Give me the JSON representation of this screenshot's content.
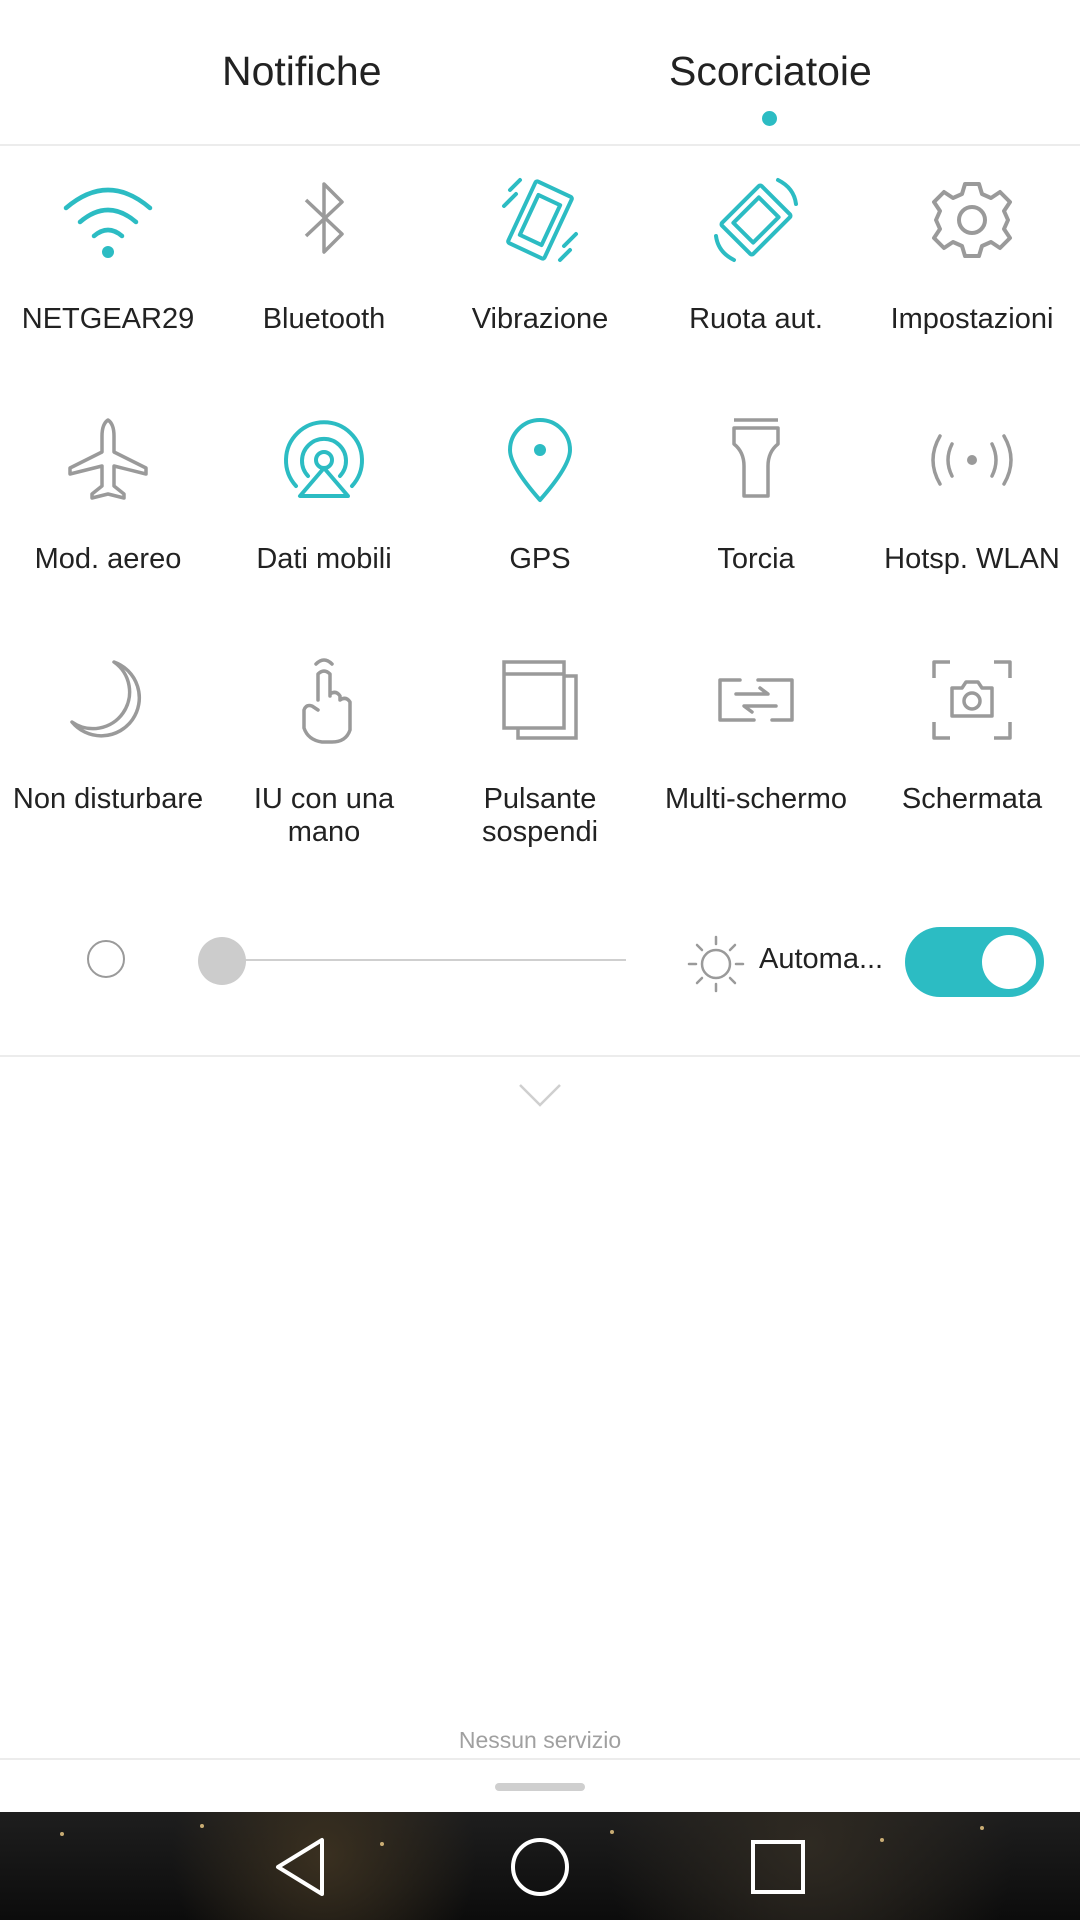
{
  "tabs": {
    "notifiche": "Notifiche",
    "scorciatoie": "Scorciatoie",
    "active": "Scorciatoie"
  },
  "colors": {
    "accent": "#2cbcc3",
    "inactive_icon": "#9a9a9a"
  },
  "tiles": [
    {
      "label": "NETGEAR29",
      "icon": "wifi-icon",
      "active": true
    },
    {
      "label": "Bluetooth",
      "icon": "bluetooth-icon",
      "active": false
    },
    {
      "label": "Vibrazione",
      "icon": "vibration-icon",
      "active": true
    },
    {
      "label": "Ruota aut.",
      "icon": "auto-rotate-icon",
      "active": true
    },
    {
      "label": "Impostazioni",
      "icon": "gear-icon",
      "active": false
    },
    {
      "label": "Mod. aereo",
      "icon": "airplane-icon",
      "active": false
    },
    {
      "label": "Dati mobili",
      "icon": "mobile-data-icon",
      "active": true
    },
    {
      "label": "GPS",
      "icon": "location-pin-icon",
      "active": true
    },
    {
      "label": "Torcia",
      "icon": "flashlight-icon",
      "active": false
    },
    {
      "label": "Hotsp. WLAN",
      "icon": "hotspot-icon",
      "active": false
    },
    {
      "label": "Non disturbare",
      "icon": "moon-icon",
      "active": false
    },
    {
      "label": "IU con una mano",
      "icon": "one-hand-icon",
      "active": false
    },
    {
      "label": "Pulsante sospendi",
      "icon": "floating-button-icon",
      "active": false
    },
    {
      "label": "Multi-schermo",
      "icon": "multi-screen-icon",
      "active": false
    },
    {
      "label": "Schermata",
      "icon": "screenshot-icon",
      "active": false
    }
  ],
  "brightness": {
    "level": 0.05,
    "auto_label": "Automa...",
    "auto_enabled": true
  },
  "status": {
    "no_service": "Nessun servizio"
  },
  "navbar": {
    "back": "back-icon",
    "home": "home-icon",
    "recent": "recent-apps-icon"
  }
}
